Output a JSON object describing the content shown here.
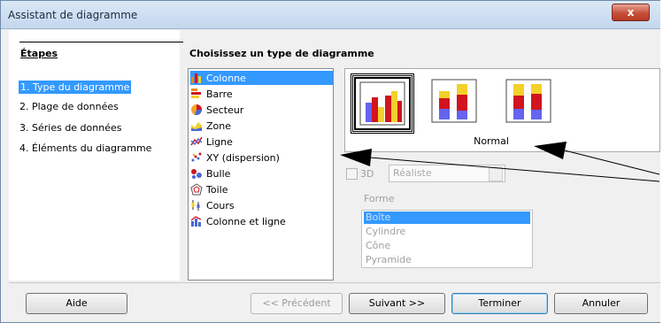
{
  "window": {
    "title": "Assistant de diagramme",
    "close_glyph": "x"
  },
  "steps": {
    "title": "Étapes",
    "items": [
      {
        "label": "1. Type du diagramme",
        "selected": true
      },
      {
        "label": "2. Plage de données",
        "selected": false
      },
      {
        "label": "3. Séries de données",
        "selected": false
      },
      {
        "label": "4. Éléments du diagramme",
        "selected": false
      }
    ]
  },
  "main": {
    "heading": "Choisissez un type de diagramme",
    "chart_types": [
      {
        "label": "Colonne",
        "icon": "column-chart-icon",
        "selected": true
      },
      {
        "label": "Barre",
        "icon": "bar-chart-icon"
      },
      {
        "label": "Secteur",
        "icon": "pie-chart-icon"
      },
      {
        "label": "Zone",
        "icon": "area-chart-icon"
      },
      {
        "label": "Ligne",
        "icon": "line-chart-icon"
      },
      {
        "label": "XY (dispersion)",
        "icon": "scatter-chart-icon"
      },
      {
        "label": "Bulle",
        "icon": "bubble-chart-icon"
      },
      {
        "label": "Toile",
        "icon": "net-chart-icon"
      },
      {
        "label": "Cours",
        "icon": "stock-chart-icon"
      },
      {
        "label": "Colonne et ligne",
        "icon": "column-line-chart-icon"
      }
    ],
    "subtype_caption": "Normal",
    "three_d": {
      "label": "3D",
      "checked": false,
      "disabled": true
    },
    "three_d_style": "Réaliste",
    "shape_label": "Forme",
    "shapes": [
      {
        "label": "Boîte",
        "selected": true
      },
      {
        "label": "Cylindre"
      },
      {
        "label": "Cône"
      },
      {
        "label": "Pyramide"
      }
    ]
  },
  "buttons": {
    "help": "Aide",
    "back": "<< Précédent",
    "next": "Suivant >>",
    "finish": "Terminer",
    "cancel": "Annuler"
  },
  "colors": {
    "selection": "#3399ff",
    "series_blue": "#6464f0",
    "series_red": "#d1141e",
    "series_yellow": "#f3d02a"
  }
}
